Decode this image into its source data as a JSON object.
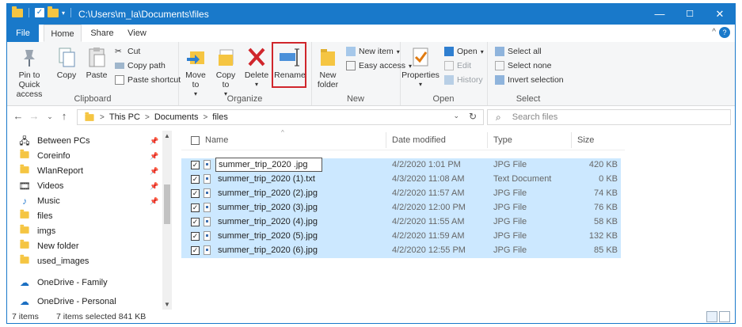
{
  "window": {
    "path": "C:\\Users\\m_la\\Documents\\files",
    "controls": {
      "minimize": "—",
      "maximize": "☐",
      "close": "✕"
    }
  },
  "tabs": {
    "file": "File",
    "home": "Home",
    "share": "Share",
    "view": "View"
  },
  "ribbon": {
    "clipboard": {
      "label": "Clipboard",
      "pin": "Pin to Quick access",
      "copy": "Copy",
      "paste": "Paste",
      "cut": "Cut",
      "copy_path": "Copy path",
      "paste_shortcut": "Paste shortcut"
    },
    "organize": {
      "label": "Organize",
      "move_to": "Move to",
      "copy_to": "Copy to",
      "delete": "Delete",
      "rename": "Rename"
    },
    "new": {
      "label": "New",
      "new_folder": "New folder",
      "new_item": "New item",
      "easy_access": "Easy access"
    },
    "open": {
      "label": "Open",
      "properties": "Properties",
      "open": "Open",
      "edit": "Edit",
      "history": "History"
    },
    "select": {
      "label": "Select",
      "select_all": "Select all",
      "select_none": "Select none",
      "invert_selection": "Invert selection"
    }
  },
  "address": {
    "crumbs": [
      "This PC",
      "Documents",
      "files"
    ],
    "search_placeholder": "Search files"
  },
  "navpane": {
    "items": [
      {
        "label": "Between PCs",
        "icon": "folder-network-icon",
        "pinned": true
      },
      {
        "label": "Coreinfo",
        "icon": "folder-icon",
        "pinned": true
      },
      {
        "label": "WlanReport",
        "icon": "folder-icon",
        "pinned": true
      },
      {
        "label": "Videos",
        "icon": "video-folder-icon",
        "pinned": true
      },
      {
        "label": "Music",
        "icon": "music-icon",
        "pinned": true
      },
      {
        "label": "files",
        "icon": "folder-icon",
        "pinned": false
      },
      {
        "label": "imgs",
        "icon": "folder-icon",
        "pinned": false
      },
      {
        "label": "New folder",
        "icon": "folder-icon",
        "pinned": false
      },
      {
        "label": "used_images",
        "icon": "folder-icon",
        "pinned": false
      },
      {
        "label": "OneDrive - Family",
        "icon": "onedrive-icon",
        "pinned": false
      },
      {
        "label": "OneDrive - Personal",
        "icon": "onedrive-icon",
        "pinned": false
      }
    ]
  },
  "columns": {
    "name": "Name",
    "date": "Date modified",
    "type": "Type",
    "size": "Size"
  },
  "files": [
    {
      "name": "summer_trip_2020 .jpg",
      "date": "4/2/2020 1:01 PM",
      "type": "JPG File",
      "size": "420 KB",
      "renaming": true
    },
    {
      "name": "summer_trip_2020 (1).txt",
      "date": "4/3/2020 11:08 AM",
      "type": "Text Document",
      "size": "0 KB"
    },
    {
      "name": "summer_trip_2020 (2).jpg",
      "date": "4/2/2020 11:57 AM",
      "type": "JPG File",
      "size": "74 KB"
    },
    {
      "name": "summer_trip_2020 (3).jpg",
      "date": "4/2/2020 12:00 PM",
      "type": "JPG File",
      "size": "76 KB"
    },
    {
      "name": "summer_trip_2020 (4).jpg",
      "date": "4/2/2020 11:55 AM",
      "type": "JPG File",
      "size": "58 KB"
    },
    {
      "name": "summer_trip_2020 (5).jpg",
      "date": "4/2/2020 11:59 AM",
      "type": "JPG File",
      "size": "132 KB"
    },
    {
      "name": "summer_trip_2020 (6).jpg",
      "date": "4/2/2020 12:55 PM",
      "type": "JPG File",
      "size": "85 KB"
    }
  ],
  "status": {
    "count": "7 items",
    "selected": "7 items selected  841 KB"
  },
  "colors": {
    "accent": "#1979ca",
    "selection": "#cce8ff",
    "highlight_box": "#d0262c"
  }
}
